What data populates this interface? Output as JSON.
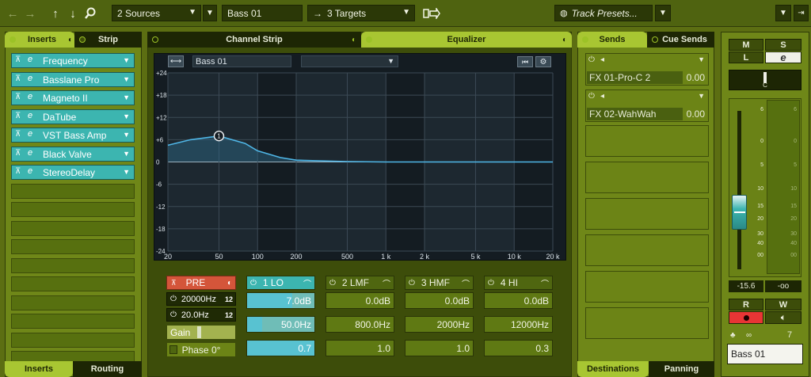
{
  "toolbar": {
    "back_icon": "arrow-left-icon",
    "forward_icon": "arrow-right-icon",
    "up_icon": "arrow-up-icon",
    "down_icon": "arrow-down-icon",
    "search_icon": "search-icon",
    "sources": "2 Sources",
    "track_name": "Bass 01",
    "targets": "3 Targets",
    "track_presets": "Track Presets...",
    "arrow_char": "→"
  },
  "inserts": {
    "tab_inserts": "Inserts",
    "tab_strip": "Strip",
    "plugins": [
      "Frequency",
      "Basslane Pro",
      "Magneto II",
      "DaTube",
      "VST Bass Amp",
      "Black Valve",
      "StereoDelay"
    ],
    "bottom_tab_inserts": "Inserts",
    "bottom_tab_routing": "Routing"
  },
  "center": {
    "tab_channel_strip": "Channel Strip",
    "tab_equalizer": "Equalizer",
    "eq_preset_name": "Bass 01",
    "y_labels": [
      "+24",
      "+18",
      "+12",
      "+6",
      "0",
      "-6",
      "-12",
      "-18",
      "-24"
    ],
    "x_labels": [
      "20",
      "50",
      "100",
      "200",
      "500",
      "1 k",
      "2 k",
      "5 k",
      "10 k",
      "20 k"
    ],
    "curve_node_label": "1"
  },
  "pre": {
    "label": "PRE",
    "hp_freq": "20000Hz",
    "lp_freq": "20.0Hz",
    "slope_icon": "12",
    "gain_label": "Gain",
    "phase_label": "Phase 0°"
  },
  "bands": [
    {
      "name": "1 LO",
      "gain": "7.0dB",
      "freq": "50.0Hz",
      "q": "0.7",
      "active": true
    },
    {
      "name": "2 LMF",
      "gain": "0.0dB",
      "freq": "800.0Hz",
      "q": "1.0",
      "active": false
    },
    {
      "name": "3 HMF",
      "gain": "0.0dB",
      "freq": "2000Hz",
      "q": "1.0",
      "active": false
    },
    {
      "name": "4 HI",
      "gain": "0.0dB",
      "freq": "12000Hz",
      "q": "0.3",
      "active": false
    }
  ],
  "sends": {
    "tab_sends": "Sends",
    "tab_cue_sends": "Cue Sends",
    "items": [
      {
        "name": "FX 01-Pro-C 2",
        "value": "0.00"
      },
      {
        "name": "FX 02-WahWah",
        "value": "0.00"
      }
    ],
    "bottom_tab_destinations": "Destinations",
    "bottom_tab_panning": "Panning"
  },
  "fader": {
    "mute": "M",
    "solo": "S",
    "listen": "L",
    "edit": "e",
    "pan_label": "C",
    "scale": [
      "6",
      "0",
      "5",
      "10",
      "15",
      "20",
      "30",
      "40",
      "00"
    ],
    "vol_readout": "-15.6",
    "peak_readout": "-oo",
    "read": "R",
    "write": "W",
    "track_number": "7",
    "track_name": "Bass 01"
  },
  "chart_data": {
    "type": "line",
    "xlabel": "",
    "ylabel": "",
    "x": [
      20,
      30,
      50,
      80,
      100,
      150,
      200,
      500,
      1000,
      5000,
      20000
    ],
    "series": [
      {
        "values": [
          4.5,
          6.0,
          7.0,
          5.0,
          3.0,
          1.2,
          0.5,
          0.1,
          0,
          0,
          0
        ]
      }
    ],
    "ylim": [
      -24,
      24
    ],
    "xlim": [
      20,
      20000
    ],
    "x_scale": "log",
    "accent_color": "#4fb6e6"
  }
}
